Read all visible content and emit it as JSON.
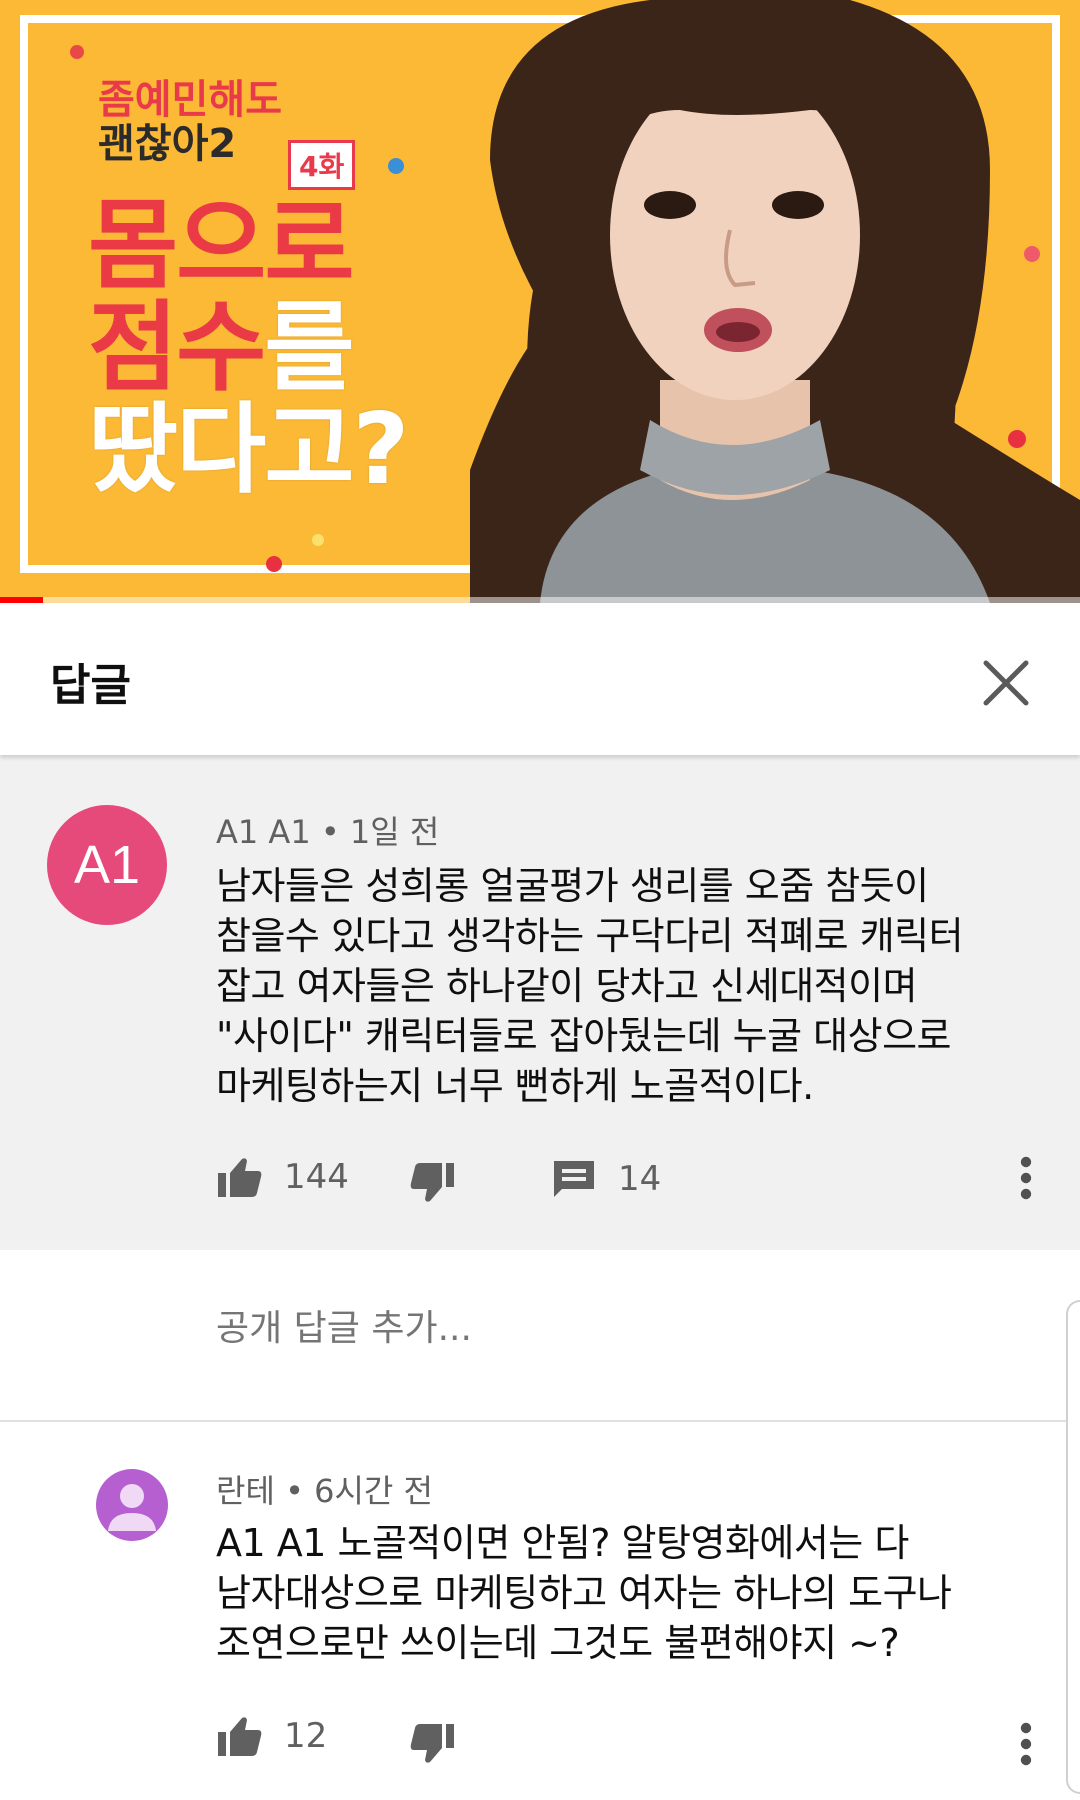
{
  "video": {
    "show_title_line1": "좀예민해도",
    "show_title_line2": "괜찮아2",
    "episode": "4화",
    "headline": {
      "line1": "몸으로",
      "line2_red": "점수",
      "line2_white": "를",
      "line3": "땄다고?"
    },
    "progress": 0.04,
    "colors": {
      "background": "#fbb935",
      "accent": "#ea3a46"
    }
  },
  "replies_panel": {
    "title": "답글",
    "close_icon": "close-icon"
  },
  "parent_comment": {
    "avatar_text": "A1",
    "avatar_color": "#e64a7b",
    "author": "A1 A1",
    "time": "1일 전",
    "text_lines": [
      "남자들은 성희롱 얼굴평가 생리를 오줌 참듯이",
      "참을수 있다고 생각하는 구닥다리 적폐로 캐릭터",
      "잡고 여자들은 하나같이 당차고 신세대적이며",
      "\"사이다\" 캐릭터들로 잡아뒀는데 누굴 대상으로",
      "마케팅하는지 너무 뻔하게 노골적이다."
    ],
    "likes": "144",
    "replies": "14"
  },
  "add_reply": {
    "placeholder": "공개 답글 추가..."
  },
  "reply_comment": {
    "avatar_color": "#b55fd0",
    "author": "란테",
    "time": "6시간 전",
    "text_lines": [
      "A1 A1 노골적이면 안됨? 알탕영화에서는 다",
      "남자대상으로 마케팅하고 여자는 하나의 도구나",
      "조연으로만 쓰이는데 그것도 불편해야지 ~?"
    ],
    "likes": "12"
  }
}
